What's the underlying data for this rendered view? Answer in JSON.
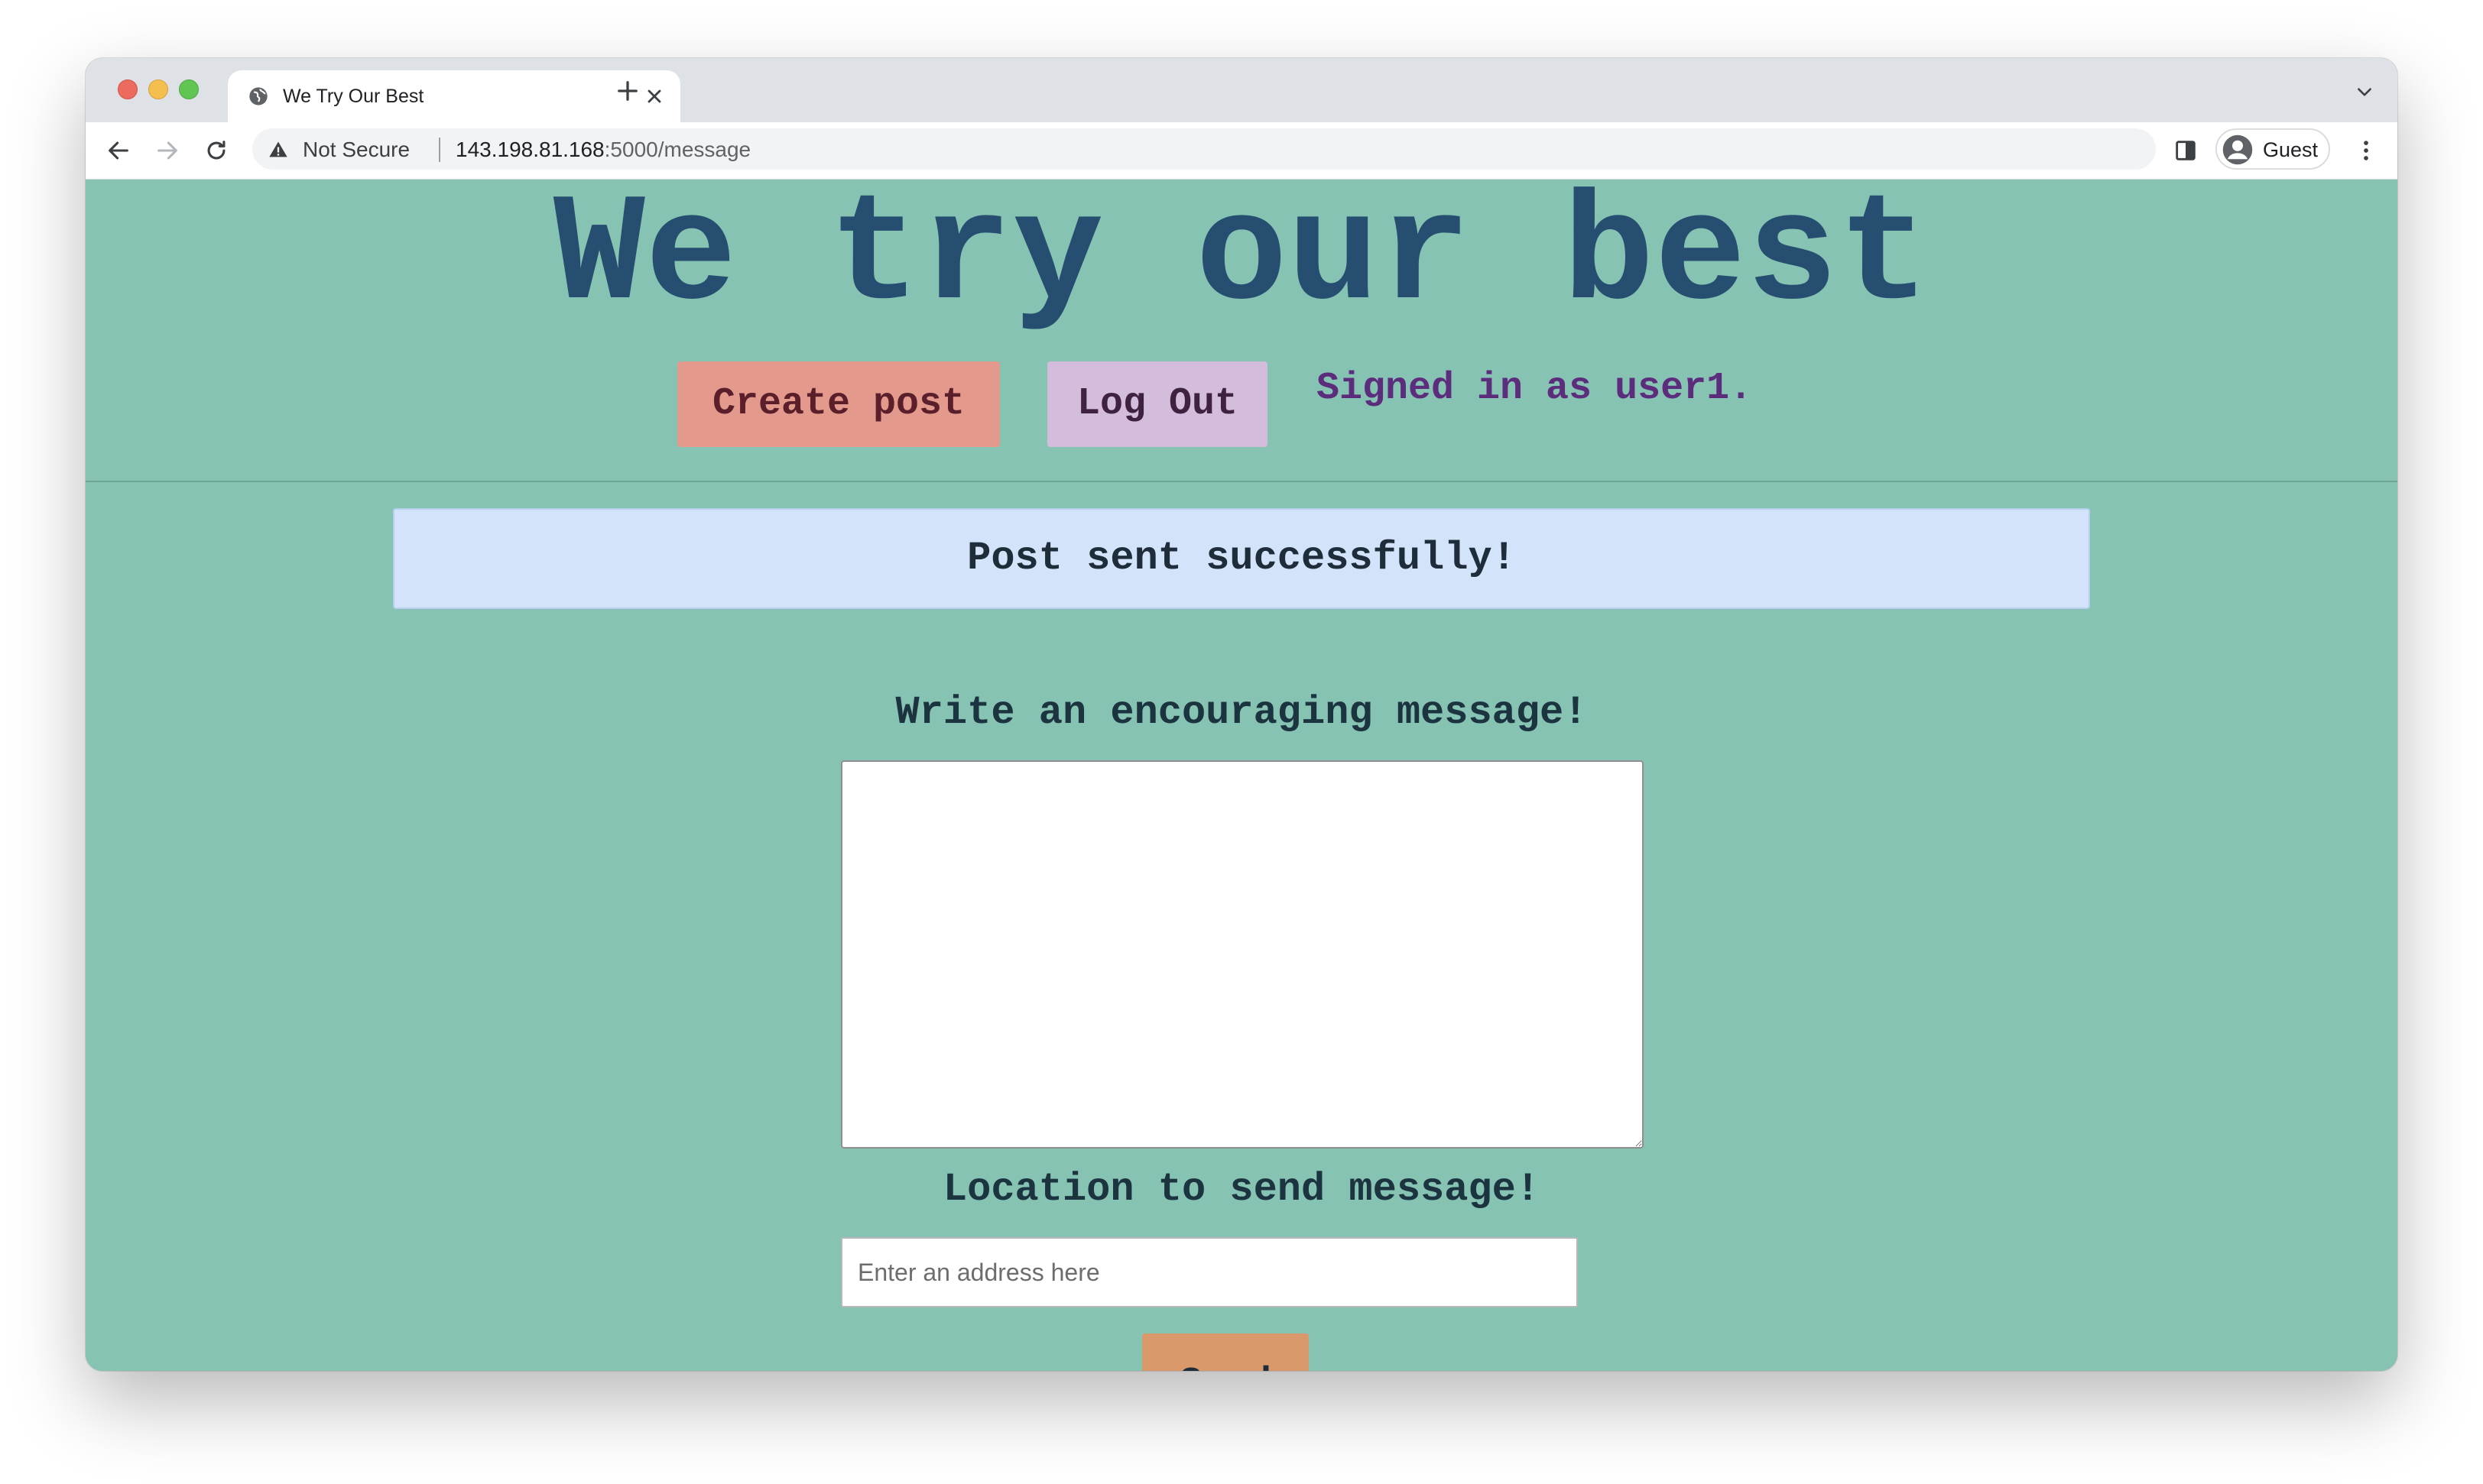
{
  "browser": {
    "tab_title": "We Try Our Best",
    "security_label": "Not Secure",
    "url_host": "143.198.81.168",
    "url_rest": ":5000/message",
    "profile_label": "Guest"
  },
  "header": {
    "site_title": "We try our best",
    "create_post_label": "Create post",
    "logout_label": "Log Out",
    "signed_in_text": "Signed in as user1."
  },
  "flash": {
    "message": "Post sent successfully!"
  },
  "form": {
    "message_label": "Write an encouraging message!",
    "message_value": "",
    "location_label": "Location to send message!",
    "location_placeholder": "Enter an address here",
    "location_value": "",
    "send_label": "Send"
  },
  "colors": {
    "page_background": "#87c3b3",
    "title_color": "#264e70",
    "create_post_bg": "#e39a8c",
    "logout_bg": "#d3bcdc",
    "signed_in_color": "#5c2d7c",
    "flash_bg": "#d2e3fa",
    "send_bg": "#d9996a"
  },
  "icons": {
    "tab_favicon": "globe-icon",
    "tab_close": "close-icon",
    "new_tab": "plus-icon",
    "back": "back-arrow-icon",
    "forward": "forward-arrow-icon",
    "reload": "reload-icon",
    "security": "warning-triangle-icon",
    "side_panel": "side-panel-icon",
    "profile": "profile-avatar-icon",
    "menu": "kebab-menu-icon"
  }
}
